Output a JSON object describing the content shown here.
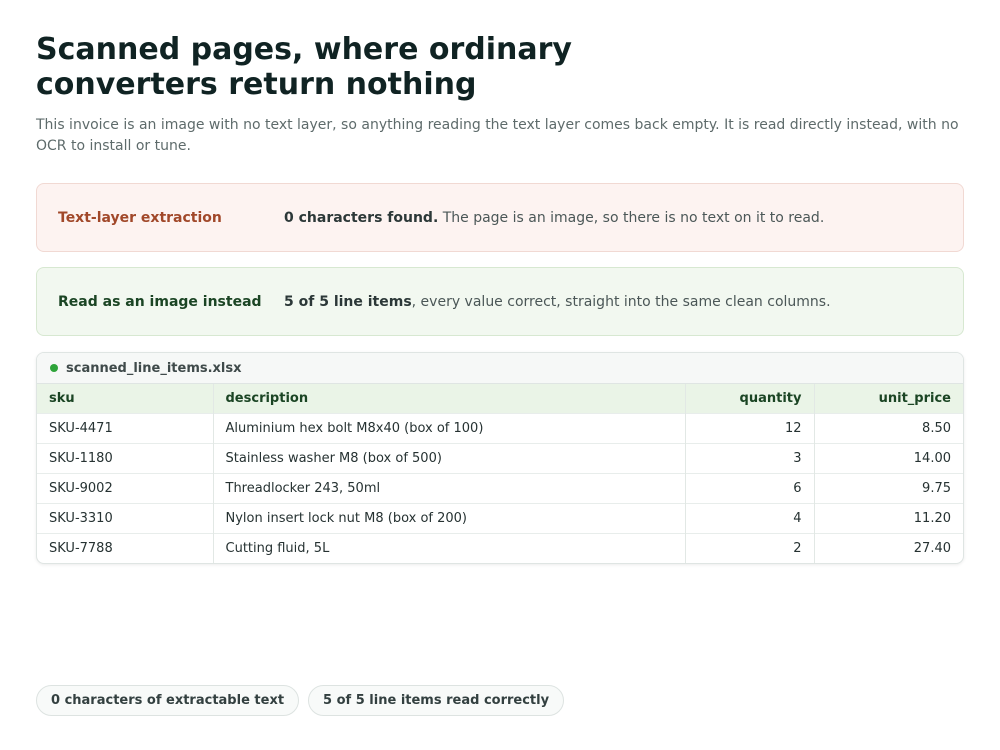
{
  "header": {
    "title": "Scanned pages, where ordinary converters return nothing",
    "subtitle": "This invoice is an image with no text layer, so anything reading the text layer comes back empty. It is read directly instead, with no OCR to install or tune."
  },
  "panels": {
    "failed": {
      "label": "Text-layer extraction",
      "emphasis": "0 characters found.",
      "text": " The page is an image, so there is no text on it to read."
    },
    "success": {
      "label": "Read as an image instead",
      "emphasis": "5 of 5 line items",
      "text": ", every value correct, straight into the same clean columns."
    }
  },
  "spreadsheet": {
    "filename": "scanned_line_items.xlsx",
    "status_color": "#2ea43a",
    "columns": [
      "sku",
      "description",
      "quantity",
      "unit_price"
    ],
    "rows": [
      [
        "SKU-4471",
        "Aluminium hex bolt M8x40 (box of 100)",
        "12",
        "8.50"
      ],
      [
        "SKU-1180",
        "Stainless washer M8 (box of 500)",
        "3",
        "14.00"
      ],
      [
        "SKU-9002",
        "Threadlocker 243, 50ml",
        "6",
        "9.75"
      ],
      [
        "SKU-3310",
        "Nylon insert lock nut M8 (box of 200)",
        "4",
        "11.20"
      ],
      [
        "SKU-7788",
        "Cutting fluid, 5L",
        "2",
        "27.40"
      ]
    ]
  },
  "chips": [
    {
      "bold": "0",
      "text": " characters of extractable text"
    },
    {
      "bold": "5 of 5",
      "text": " line items read correctly"
    }
  ]
}
